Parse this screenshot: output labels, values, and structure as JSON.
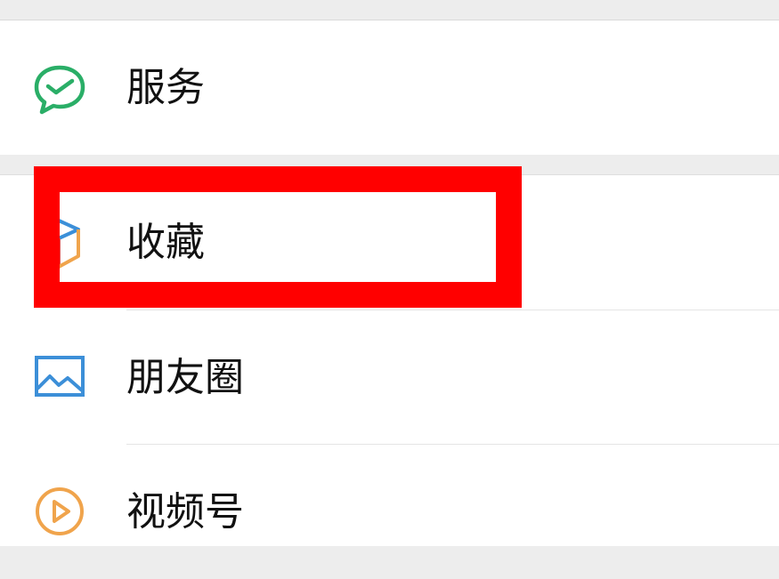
{
  "menu": {
    "items": [
      {
        "id": "services",
        "label": "服务",
        "icon": "wechat-pay-icon",
        "color": "#2aae67"
      },
      {
        "id": "favorites",
        "label": "收藏",
        "icon": "cube-icon",
        "color": "#e05a5a"
      },
      {
        "id": "moments",
        "label": "朋友圈",
        "icon": "picture-icon",
        "color": "#3c8fd8"
      },
      {
        "id": "channels",
        "label": "视频号",
        "icon": "play-circle-icon",
        "color": "#f0a44c"
      }
    ]
  },
  "annotation": {
    "target": "favorites",
    "color": "#ff0000"
  }
}
